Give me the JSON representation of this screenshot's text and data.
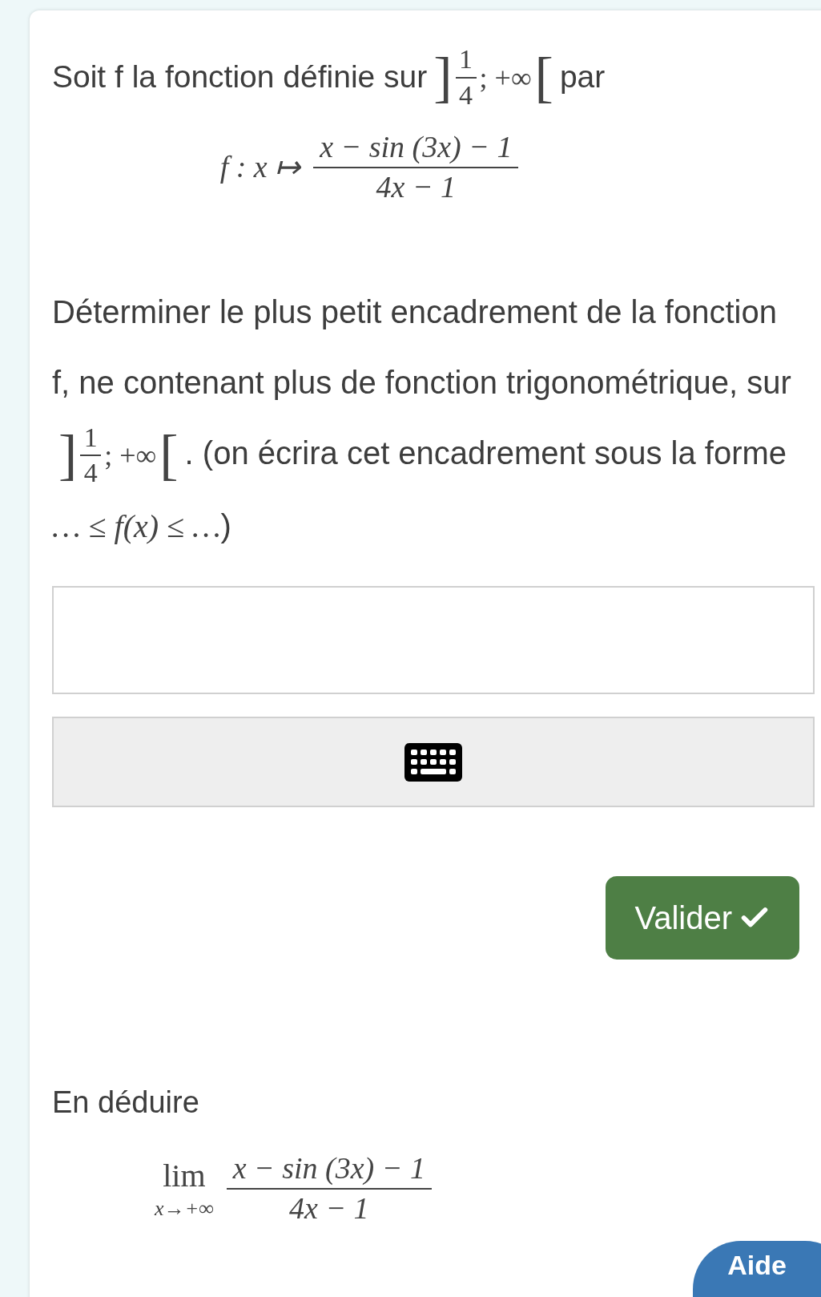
{
  "intro": {
    "before": "Soit f la fonction définie sur",
    "interval": {
      "left": "]",
      "numerator": "1",
      "denominator": "4",
      "rest": "; +∞",
      "right": "["
    },
    "after": "par"
  },
  "definition": {
    "lhs": "f : x ↦",
    "numerator": "x − sin (3x) − 1",
    "denominator": "4x − 1"
  },
  "question": {
    "before": "Déterminer le plus petit encadrement de la fonction f, ne contenant plus de fonction trigonométrique, sur",
    "interval": {
      "left": "]",
      "numerator": "1",
      "denominator": "4",
      "rest": "; +∞",
      "right": "["
    },
    "middle": ". (on écrira cet encadrement sous la forme",
    "math": "… ≤ f(x) ≤ …",
    "after": ")"
  },
  "submit": {
    "label": "Valider"
  },
  "deduce": {
    "text": "En déduire",
    "lim": "lim",
    "under": "x→+∞",
    "numerator": "x − sin (3x) − 1",
    "denominator": "4x − 1"
  },
  "help": {
    "label": "Aide"
  }
}
